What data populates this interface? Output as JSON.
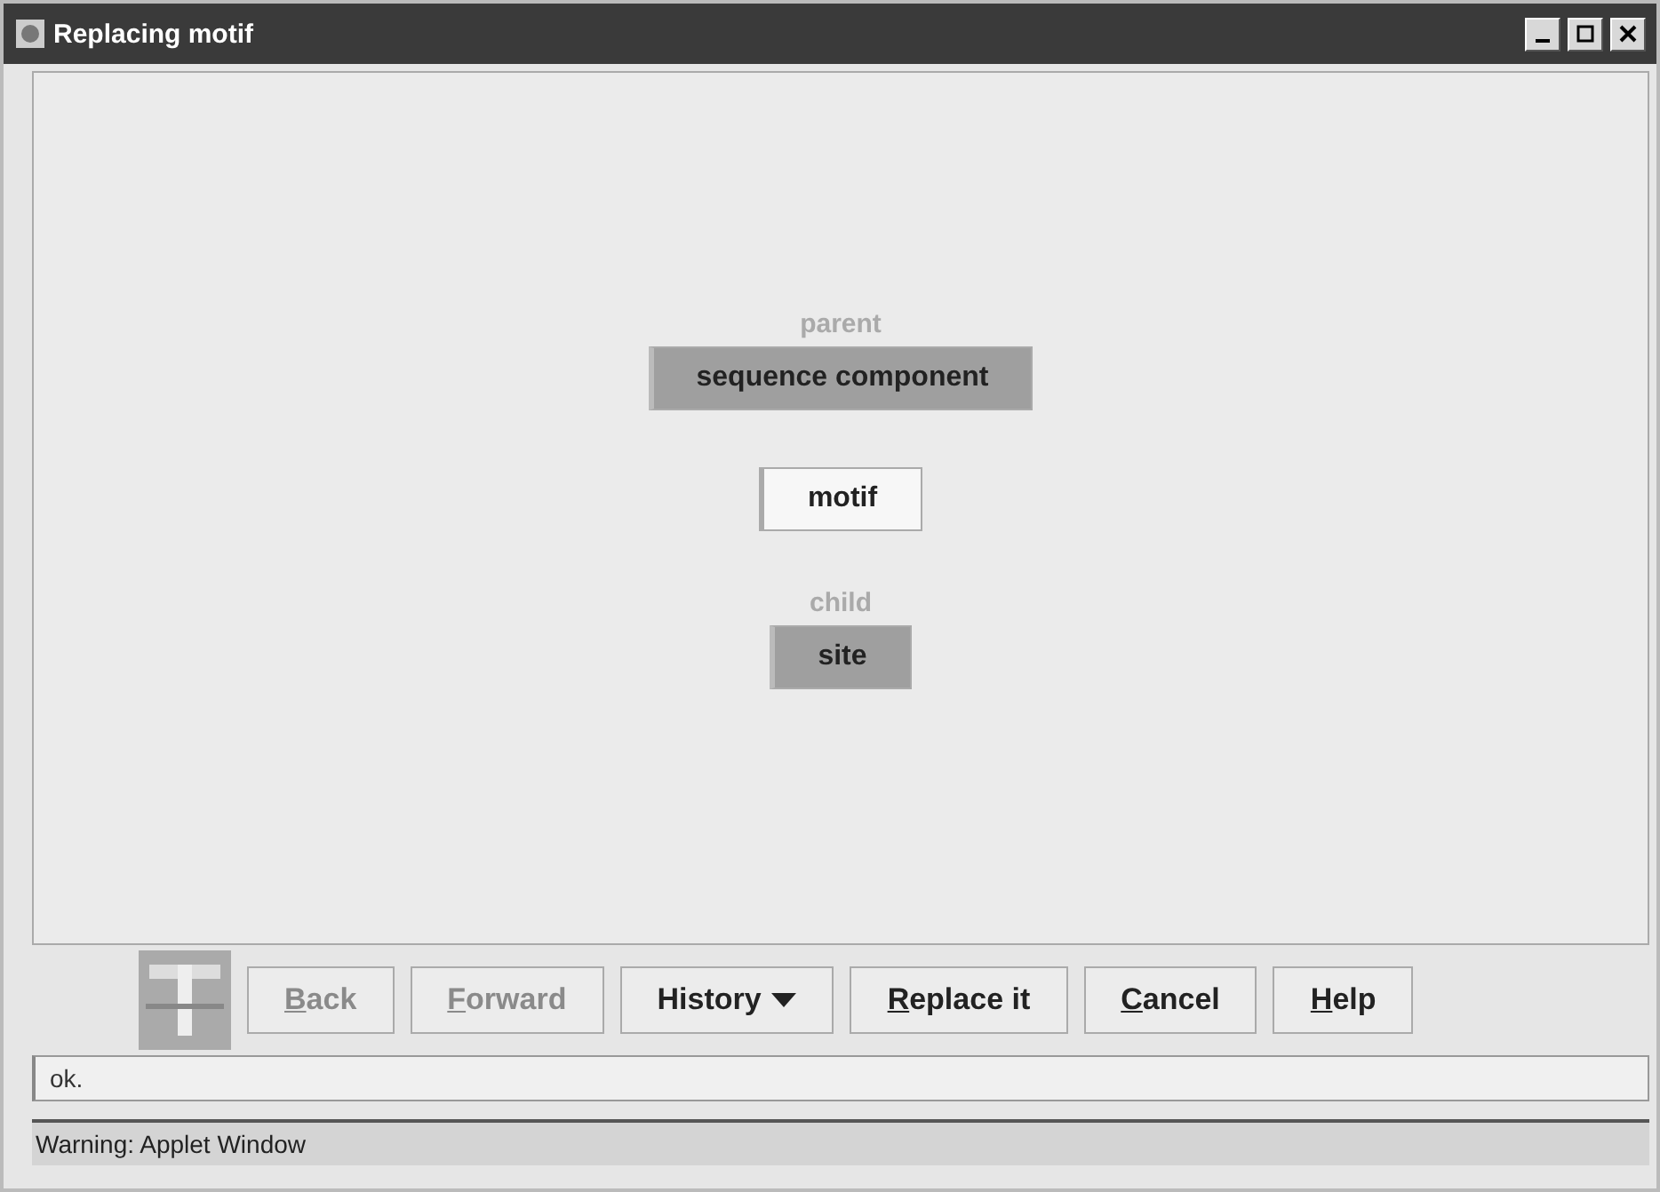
{
  "window": {
    "title": "Replacing motif"
  },
  "nodes": [
    {
      "caption": "parent",
      "label": "sequence component",
      "kind": "filled"
    },
    {
      "label": "motif",
      "kind": "outlined"
    },
    {
      "caption": "child",
      "label": "site",
      "kind": "filled"
    }
  ],
  "buttons": [
    {
      "label": "Back",
      "disabled": true,
      "underline_first": true,
      "dropdown": false
    },
    {
      "label": "Forward",
      "disabled": true,
      "underline_first": true,
      "dropdown": false
    },
    {
      "label": "History",
      "disabled": false,
      "underline_first": false,
      "dropdown": true
    },
    {
      "label": "Replace it",
      "disabled": false,
      "underline_first": true,
      "dropdown": false
    },
    {
      "label": "Cancel",
      "disabled": false,
      "underline_first": true,
      "dropdown": false
    },
    {
      "label": "Help",
      "disabled": false,
      "underline_first": true,
      "dropdown": false
    }
  ],
  "status": "ok.",
  "warning": "Warning: Applet Window"
}
